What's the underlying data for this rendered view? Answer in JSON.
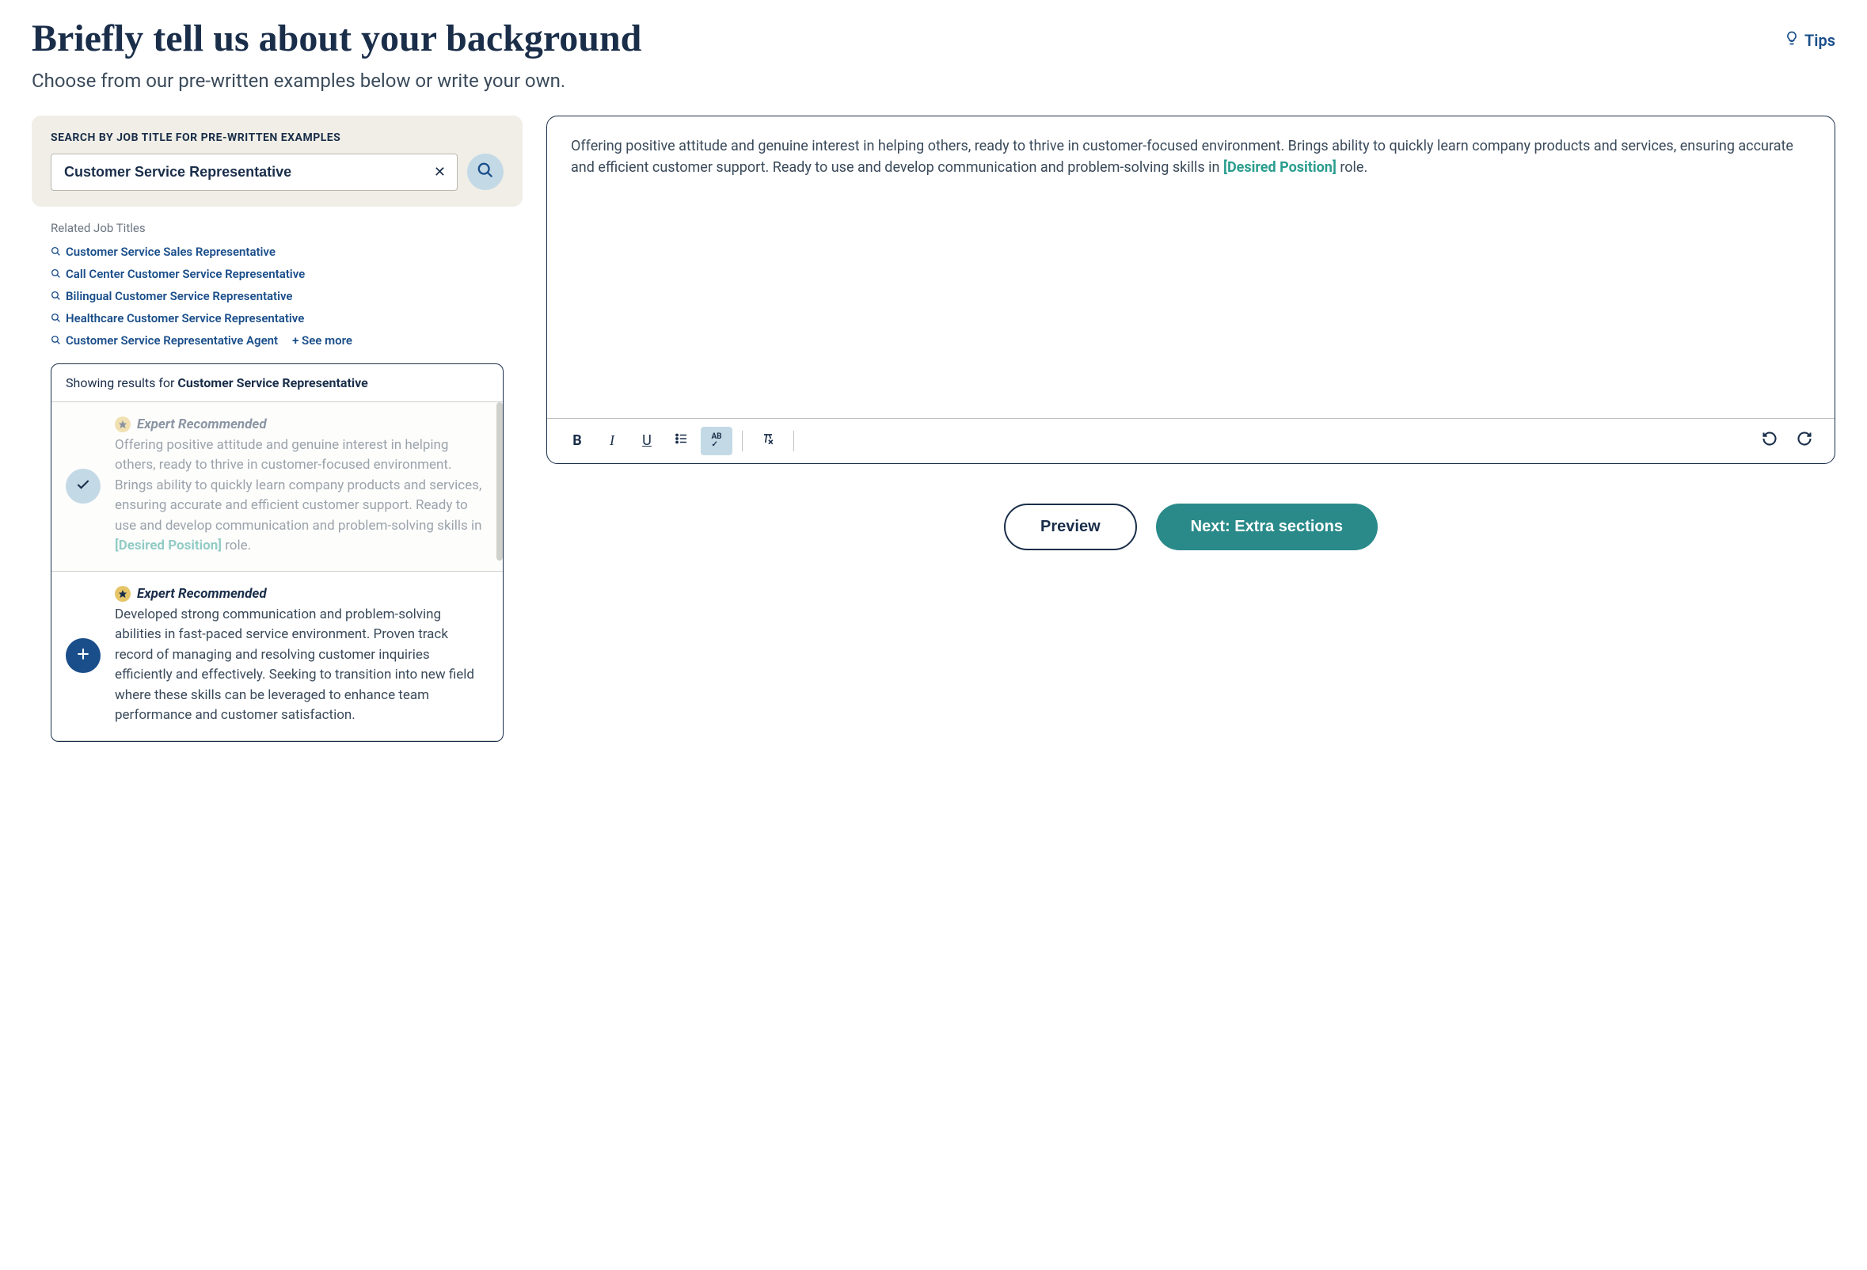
{
  "header": {
    "title": "Briefly tell us about your background",
    "subtitle": "Choose from our pre-written examples below or write your own.",
    "tips_label": "Tips"
  },
  "search": {
    "label": "SEARCH BY JOB TITLE FOR PRE-WRITTEN EXAMPLES",
    "value": "Customer Service Representative"
  },
  "related": {
    "label": "Related Job Titles",
    "items": [
      "Customer Service Sales Representative",
      "Call Center Customer Service Representative",
      "Bilingual Customer Service Representative",
      "Healthcare Customer Service Representative",
      "Customer Service Representative Agent"
    ],
    "see_more": "+ See more"
  },
  "results": {
    "showing_prefix": "Showing results for ",
    "showing_term": "Customer Service Representative",
    "expert_label": "Expert Recommended",
    "items": [
      {
        "selected": true,
        "text_before": "Offering positive attitude and genuine interest in helping others, ready to thrive in customer-focused environment. Brings ability to quickly learn company products and services, ensuring accurate and efficient customer support. Ready to use and develop communication and problem-solving skills in ",
        "placeholder": "[Desired Position]",
        "text_after": " role."
      },
      {
        "selected": false,
        "text_before": "Developed strong communication and problem-solving abilities in fast-paced service environment. Proven track record of managing and resolving customer inquiries efficiently and effectively. Seeking to transition into new field where these skills can be leveraged to enhance team performance and customer satisfaction.",
        "placeholder": "",
        "text_after": ""
      }
    ]
  },
  "editor": {
    "text_before": "Offering positive attitude and genuine interest in helping others, ready to thrive in customer-focused environment. Brings ability to quickly learn company products and services, ensuring accurate and efficient customer support. Ready to use and develop communication and problem-solving skills in ",
    "placeholder": "[Desired Position]",
    "text_after": " role."
  },
  "actions": {
    "preview": "Preview",
    "next": "Next: Extra sections"
  }
}
